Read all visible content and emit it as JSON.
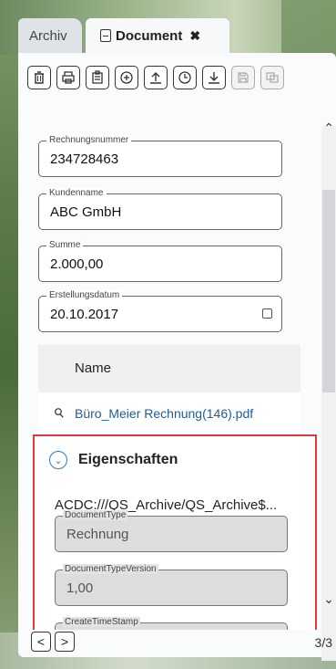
{
  "tabs": [
    {
      "label": "Archiv"
    },
    {
      "label": "Document",
      "close": "✖"
    }
  ],
  "toolbar": {
    "buttons": [
      "delete-icon",
      "print-icon",
      "clipboard-icon",
      "add-icon",
      "upload-icon",
      "history-icon",
      "download-icon",
      "save-icon",
      "copy-icon"
    ]
  },
  "fields": [
    {
      "label": "Rechnungsnummer",
      "value": "234728463"
    },
    {
      "label": "Kundenname",
      "value": "ABC GmbH"
    },
    {
      "label": "Summe",
      "value": "2.000,00"
    },
    {
      "label": "Erstellungsdatum",
      "value": "20.10.2017"
    }
  ],
  "attachments": {
    "header": "Name",
    "items": [
      {
        "name": "Büro_Meier Rechnung(146).pdf"
      }
    ]
  },
  "properties": {
    "title": "Eigenschaften",
    "path": "ACDC:///QS_Archive/QS_Archive$...",
    "fields": [
      {
        "label": "DocumentType",
        "value": "Rechnung"
      },
      {
        "label": "DocumentTypeVersion",
        "value": "1,00"
      },
      {
        "label": "CreateTimeStamp",
        "value": ""
      }
    ]
  },
  "footer": {
    "prev": "<",
    "next": ">",
    "page": "3/3"
  }
}
